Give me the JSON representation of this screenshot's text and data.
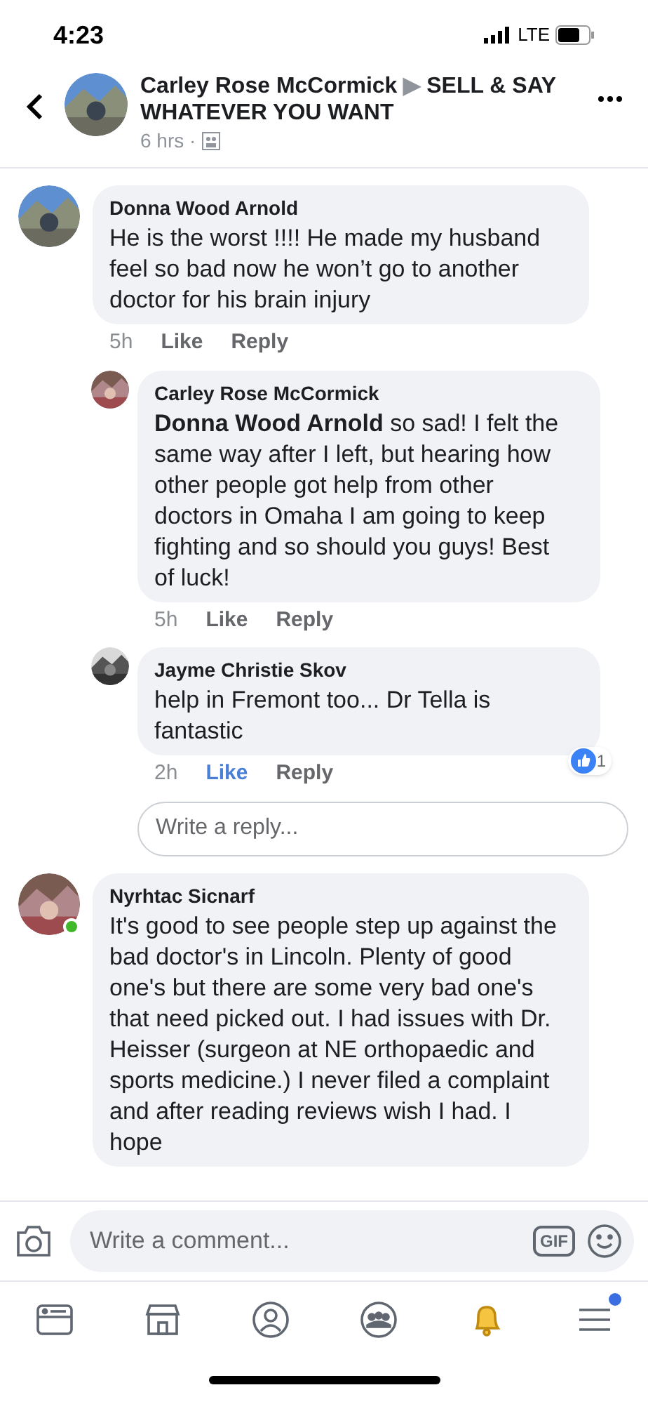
{
  "status_bar": {
    "time": "4:23",
    "network": "LTE"
  },
  "post_header": {
    "author": "Carley Rose McCormick",
    "separator": "▶",
    "group": "SELL & SAY WHATEVER YOU WANT",
    "time": "6 hrs ·"
  },
  "comments": [
    {
      "kind": "comment",
      "author": "Donna Wood Arnold",
      "text": "He is the worst !!!! He made my husband feel so bad now he won’t go to another doctor for his brain injury",
      "time": "5h",
      "like": "Like",
      "liked": false,
      "reply": "Reply",
      "online": false
    },
    {
      "kind": "reply",
      "author": "Carley Rose McCormick",
      "text": "**Donna Wood Arnold** so sad! I felt the same way after I left, but hearing how other people got help from other doctors in Omaha I am going to keep fighting and so should you guys! Best of luck!",
      "time": "5h",
      "like": "Like",
      "liked": false,
      "reply": "Reply",
      "online": false
    },
    {
      "kind": "reply",
      "author": "Jayme Christie Skov",
      "text": "help in Fremont too...  Dr Tella is fantastic",
      "time": "2h",
      "like": "Like",
      "liked": true,
      "reply": "Reply",
      "reactions": "1",
      "online": false
    },
    {
      "kind": "reply_box",
      "placeholder": "Write a reply..."
    },
    {
      "kind": "comment",
      "author": "Nyrhtac Sicnarf",
      "text": "It's good to see people step up against the bad doctor's in Lincoln. Plenty of good one's but there are some very bad one's that need picked out. I had issues with Dr. Heisser (surgeon at NE orthopaedic and sports medicine.) I never filed a complaint and after reading reviews wish I had. I hope",
      "online": true
    }
  ],
  "comment_bar": {
    "placeholder": "Write a comment...",
    "gif": "GIF"
  },
  "tabs": [
    {
      "selected": false,
      "badge": false
    },
    {
      "selected": false,
      "badge": false
    },
    {
      "selected": false,
      "badge": false
    },
    {
      "selected": false,
      "badge": false
    },
    {
      "selected": true,
      "badge": false
    },
    {
      "selected": false,
      "badge": true
    }
  ]
}
